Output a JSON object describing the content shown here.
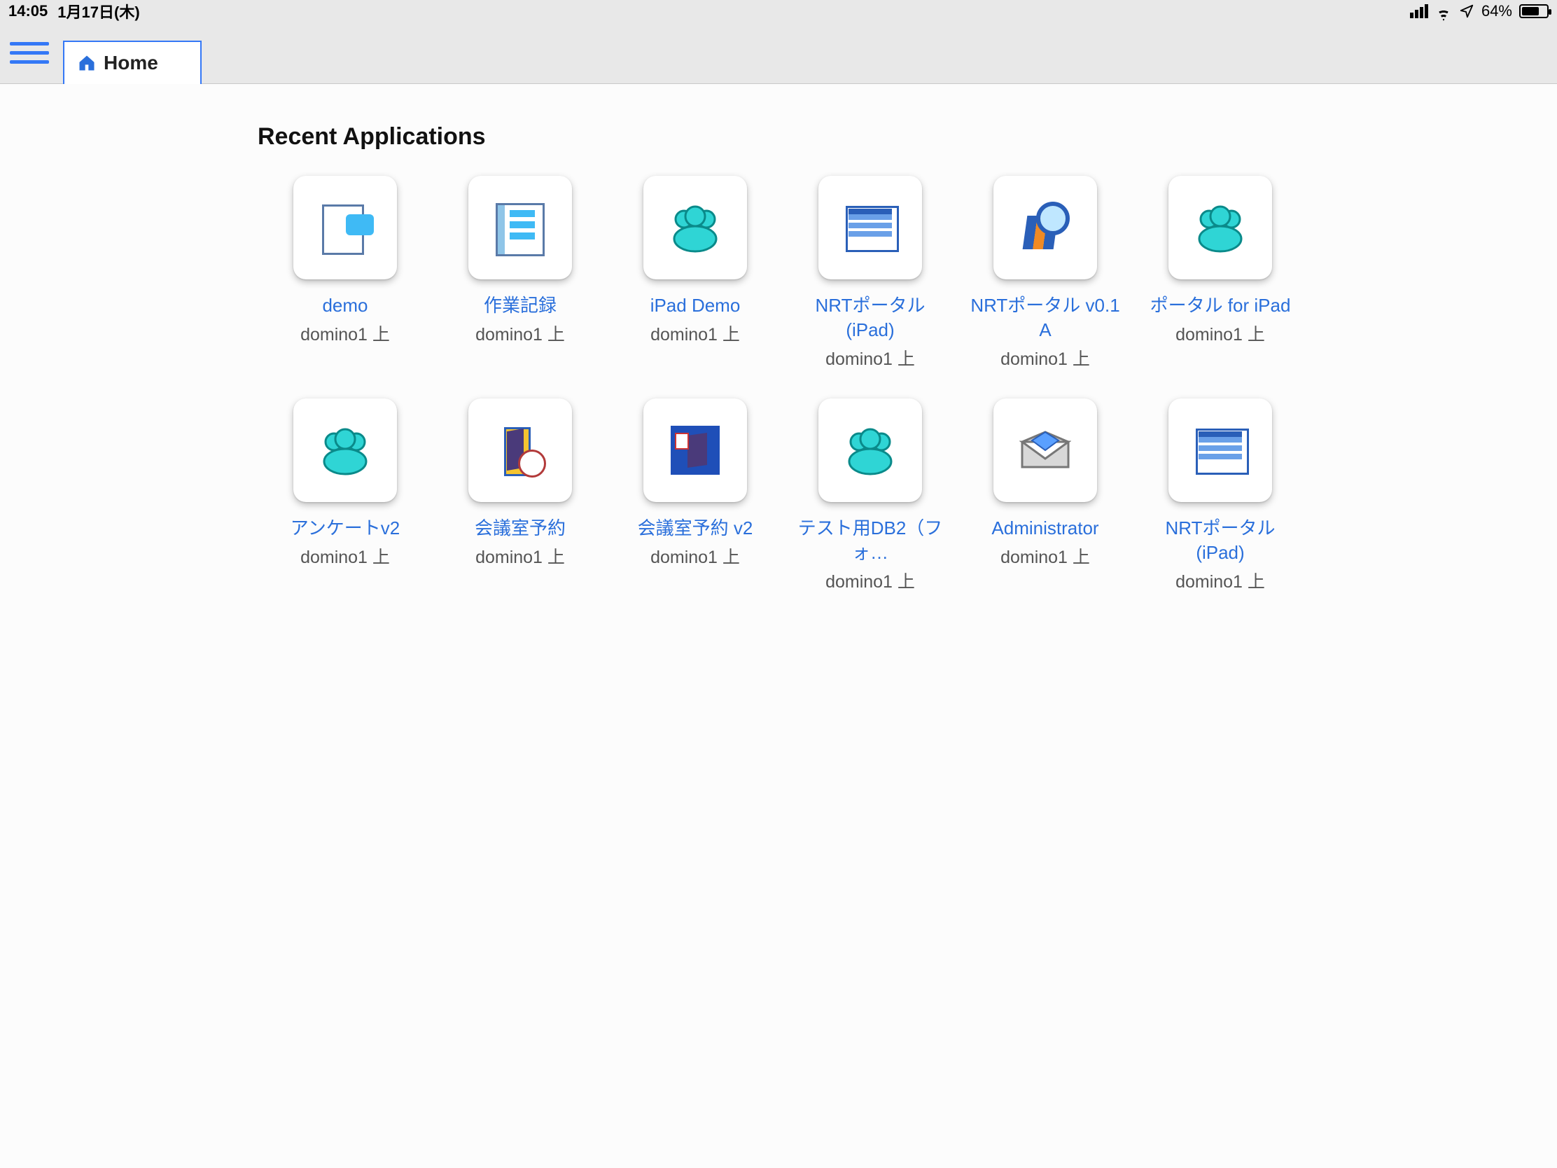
{
  "status": {
    "time": "14:05",
    "date": "1月17日(木)",
    "battery_pct": "64%"
  },
  "header": {
    "tab_label": "Home"
  },
  "section_title": "Recent Applications",
  "apps": [
    {
      "name": "demo",
      "server": "domino1 上",
      "icon": "demo"
    },
    {
      "name": "作業記録",
      "server": "domino1 上",
      "icon": "note"
    },
    {
      "name": "iPad Demo",
      "server": "domino1 上",
      "icon": "people"
    },
    {
      "name": "NRTポータル (iPad)",
      "server": "domino1 上",
      "icon": "table"
    },
    {
      "name": "NRTポータル v0.1 A",
      "server": "domino1 上",
      "icon": "books"
    },
    {
      "name": "ポータル for iPad",
      "server": "domino1 上",
      "icon": "people"
    },
    {
      "name": "アンケートv2",
      "server": "domino1 上",
      "icon": "people"
    },
    {
      "name": "会議室予約",
      "server": "domino1 上",
      "icon": "door"
    },
    {
      "name": "会議室予約 v2",
      "server": "domino1 上",
      "icon": "exit"
    },
    {
      "name": "テスト用DB2（フォ…",
      "server": "domino1 上",
      "icon": "people"
    },
    {
      "name": "Administrator",
      "server": "domino1 上",
      "icon": "mail"
    },
    {
      "name": "NRTポータル (iPad)",
      "server": "domino1 上",
      "icon": "table"
    }
  ]
}
